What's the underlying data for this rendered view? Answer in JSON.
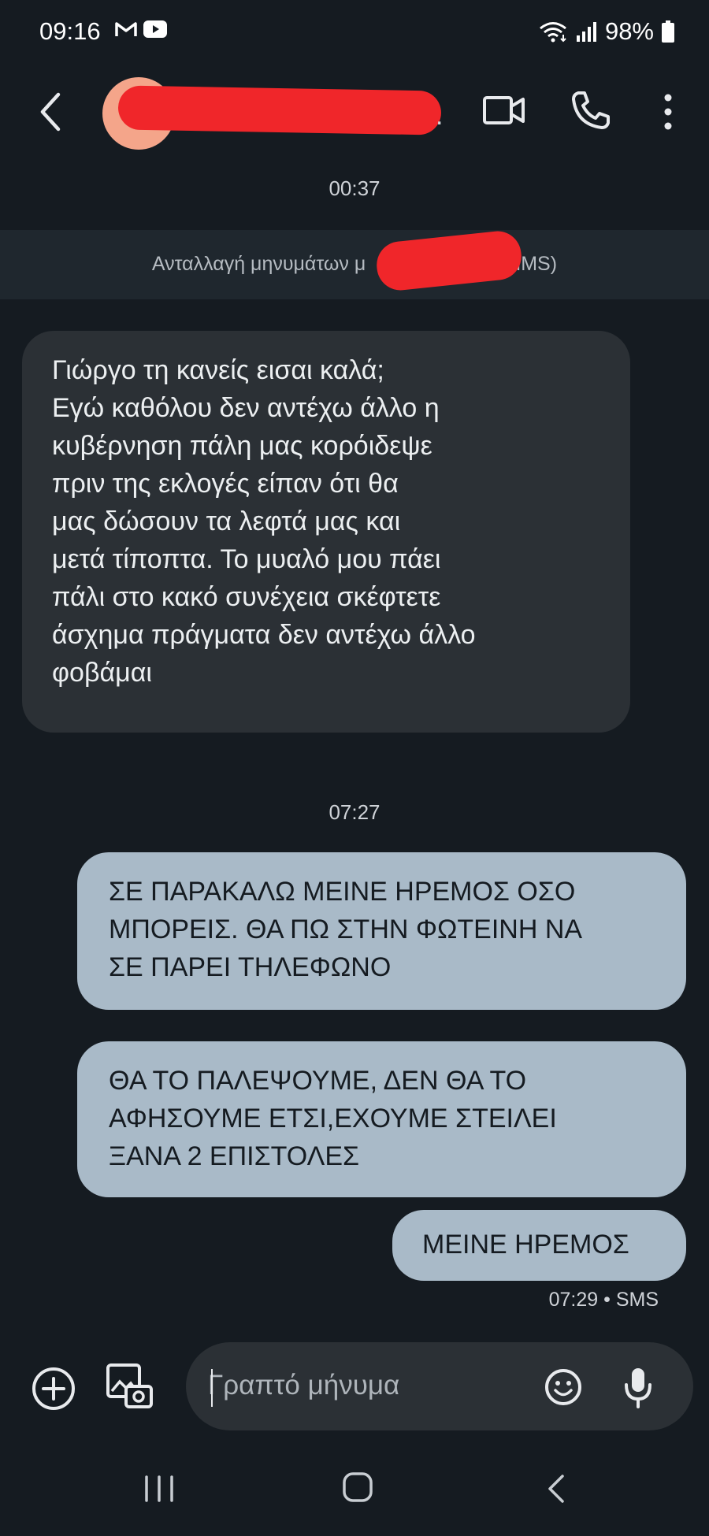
{
  "status_bar": {
    "time": "09:16",
    "battery": "98%",
    "icons": [
      "gmail-icon",
      "youtube-icon",
      "wifi-icon",
      "signal-icon",
      "battery-icon"
    ]
  },
  "header": {
    "contact_name_suffix": ".",
    "icons": [
      "back-arrow-icon",
      "video-call-icon",
      "phone-icon",
      "more-vert-icon"
    ],
    "avatar_color": "#f4a58a"
  },
  "conversation": {
    "first_time": "00:37",
    "banner_text_left": "Ανταλλαγή μηνυμάτων μ",
    "banner_text_right": "SMS/MMS)",
    "received_message": "Γιώργο τη κανείς εισαι καλά;\nΕγώ καθόλου δεν αντέχω άλλο η\nκυβέρνηση πάλη μας κορόιδεψε\nπριν της εκλογές είπαν ότι θα\nμας δώσουν τα λεφτά μας και\nμετά τίποπτα. Το μυαλό μου πάει\nπάλι στο κακό συνέχεια σκέφτετε\nάσχημα πράγματα δεν αντέχω άλλο\nφοβάμαι",
    "second_time": "07:27",
    "sent_messages": [
      "ΣΕ ΠΑΡΑΚΑΛΩ ΜΕΙΝΕ ΗΡΕΜΟΣ ΟΣΟ\nΜΠΟΡΕΙΣ. ΘΑ ΠΩ ΣΤΗΝ ΦΩΤΕΙΝΗ ΝΑ\nΣΕ ΠΑΡΕΙ ΤΗΛΕΦΩΝΟ",
      "ΘΑ ΤΟ ΠΑΛΕΨΟΥΜΕ, ΔΕΝ ΘΑ ΤΟ\nΑΦΗΣΟΥΜΕ ΕΤΣΙ,ΕΧΟΥΜΕ ΣΤΕΙΛΕΙ\nΞΑΝΑ 2 ΕΠΙΣΤΟΛΕΣ",
      "ΜΕΙΝΕ ΗΡΕΜΟΣ"
    ],
    "sent_meta": "07:29 • SMS"
  },
  "composer": {
    "placeholder": "Γραπτό μήνυμα",
    "icons": [
      "add-icon",
      "gallery-camera-icon",
      "emoji-icon",
      "mic-icon"
    ]
  },
  "colors": {
    "background": "#151b21",
    "incoming_bubble": "#2b3035",
    "outgoing_bubble": "#a9bac8",
    "redaction": "#f0262a"
  }
}
